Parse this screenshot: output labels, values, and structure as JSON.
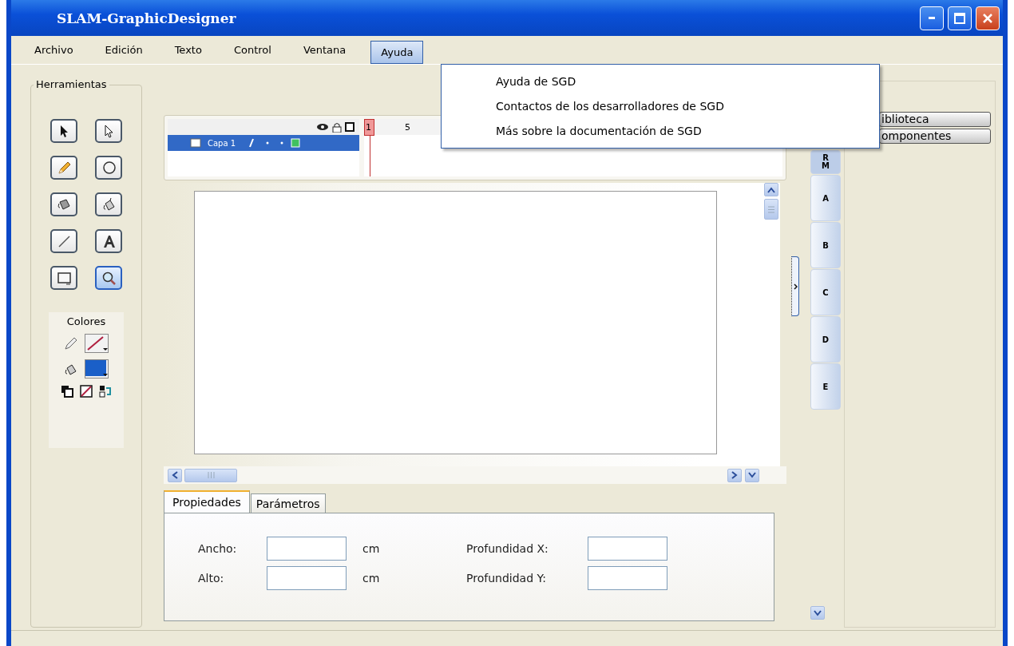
{
  "window": {
    "title": "SLAM-GraphicDesigner"
  },
  "menu": [
    {
      "label": "Archivo",
      "selected": false
    },
    {
      "label": "Edición",
      "selected": false
    },
    {
      "label": "Texto",
      "selected": false
    },
    {
      "label": "Control",
      "selected": false
    },
    {
      "label": "Ventana",
      "selected": false
    },
    {
      "label": "Ayuda",
      "selected": true
    }
  ],
  "dropdown": {
    "items": [
      "Ayuda de SGD",
      "Contactos de los desarrolladores de SGD",
      "Más sobre la documentación de SGD"
    ]
  },
  "toolbox": {
    "title": "Herramientas",
    "tools": [
      {
        "selected": false
      },
      {
        "selected": false
      },
      {
        "selected": false
      },
      {
        "selected": false
      },
      {
        "selected": false
      },
      {
        "selected": false
      },
      {
        "selected": false
      },
      {
        "selected": false
      },
      {
        "selected": false
      },
      {
        "selected": true
      }
    ],
    "colors_title": "Colores"
  },
  "timeline": {
    "layers": [
      {
        "name": "Capa 1",
        "selected": true
      }
    ],
    "frame_labels": [
      "1",
      "5"
    ]
  },
  "side_tabs": [
    {
      "label": "RM",
      "selected": true
    },
    {
      "label": "A",
      "selected": false
    },
    {
      "label": "B",
      "selected": false
    },
    {
      "label": "C",
      "selected": false
    },
    {
      "label": "D",
      "selected": false
    },
    {
      "label": "E",
      "selected": false
    }
  ],
  "library_buttons": [
    "iblioteca",
    "omponentes"
  ],
  "properties": {
    "tabs": [
      {
        "label": "Propiedades",
        "selected": true
      },
      {
        "label": "Parámetros",
        "selected": false
      }
    ],
    "rows": [
      {
        "label": "Ancho:",
        "unit": "cm",
        "depth_label": "Profundidad X:"
      },
      {
        "label": "Alto:",
        "unit": "cm",
        "depth_label": "Profundidad Y:"
      }
    ]
  }
}
